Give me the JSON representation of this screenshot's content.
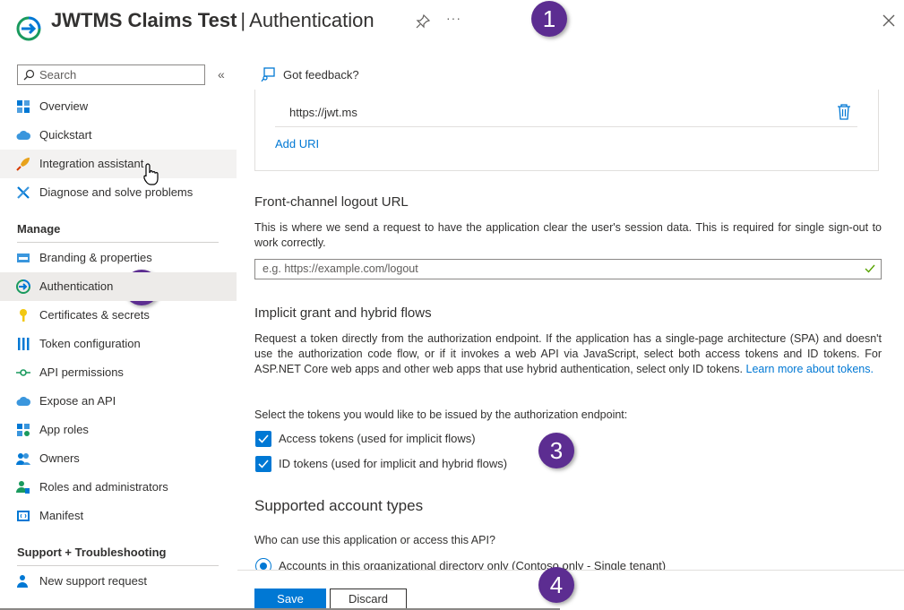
{
  "header": {
    "app_name": "JWTMS Claims Test",
    "separator": "|",
    "page_name": "Authentication",
    "more_label": "···"
  },
  "badges": [
    "1",
    "2",
    "3",
    "4"
  ],
  "sidebar": {
    "search_placeholder": "Search",
    "collapse_label": "«",
    "top_items": [
      {
        "label": "Overview",
        "icon": "overview-grid-icon"
      },
      {
        "label": "Quickstart",
        "icon": "quickstart-cloud-icon"
      },
      {
        "label": "Integration assistant",
        "icon": "rocket-icon"
      },
      {
        "label": "Diagnose and solve problems",
        "icon": "wrench-icon"
      }
    ],
    "manage_header": "Manage",
    "manage_items": [
      {
        "label": "Branding & properties",
        "icon": "branding-icon"
      },
      {
        "label": "Authentication",
        "icon": "authentication-icon"
      },
      {
        "label": "Certificates & secrets",
        "icon": "key-icon"
      },
      {
        "label": "Token configuration",
        "icon": "token-config-icon"
      },
      {
        "label": "API permissions",
        "icon": "api-permissions-icon"
      },
      {
        "label": "Expose an API",
        "icon": "expose-api-cloud-icon"
      },
      {
        "label": "App roles",
        "icon": "app-roles-icon"
      },
      {
        "label": "Owners",
        "icon": "owners-icon"
      },
      {
        "label": "Roles and administrators",
        "icon": "roles-admin-icon"
      },
      {
        "label": "Manifest",
        "icon": "manifest-icon"
      }
    ],
    "support_header": "Support + Troubleshooting",
    "support_items": [
      {
        "label": "New support request",
        "icon": "support-request-icon"
      }
    ]
  },
  "main": {
    "feedback_label": "Got feedback?",
    "redirect_uri": "https://jwt.ms",
    "add_uri_label": "Add URI",
    "logout": {
      "title": "Front-channel logout URL",
      "description": "This is where we send a request to have the application clear the user's session data. This is required for single sign-out to work correctly.",
      "placeholder": "e.g. https://example.com/logout"
    },
    "implicit": {
      "title": "Implicit grant and hybrid flows",
      "description": "Request a token directly from the authorization endpoint. If the application has a single-page architecture (SPA) and doesn't use the authorization code flow, or if it invokes a web API via JavaScript, select both access tokens and ID tokens. For ASP.NET Core web apps and other web apps that use hybrid authentication, select only ID tokens.",
      "learn_more": "Learn more about tokens.",
      "select_prompt": "Select the tokens you would like to be issued by the authorization endpoint:",
      "access_tokens_label": "Access tokens (used for implicit flows)",
      "id_tokens_label": "ID tokens (used for implicit and hybrid flows)",
      "access_tokens_checked": true,
      "id_tokens_checked": true
    },
    "account_types": {
      "title": "Supported account types",
      "question": "Who can use this application or access this API?",
      "option_single_tenant": "Accounts in this organizational directory only (Contoso only - Single tenant)"
    }
  },
  "footer": {
    "save_label": "Save",
    "discard_label": "Discard"
  },
  "colors": {
    "accent": "#0078d4",
    "badge": "#5c2d91",
    "active_nav": "#edebe9"
  }
}
